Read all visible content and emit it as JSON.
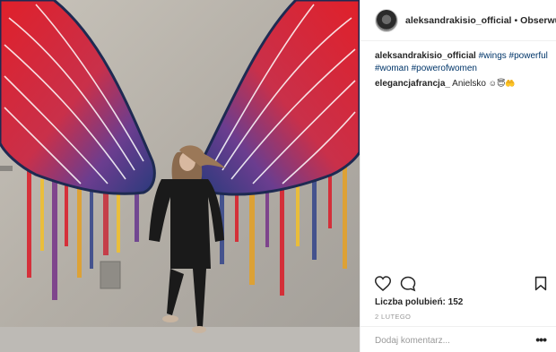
{
  "post": {
    "username": "aleksandrakisio_official",
    "follow_label": "Obserwuj",
    "separator": "•",
    "caption_user": "aleksandrakisio_official",
    "hashtags": [
      "#wings",
      "#powerful",
      "#woman",
      "#powerofwomen"
    ],
    "comment_user": "elegancjafrancja_",
    "comment_text": "Anielsko",
    "comment_emoji": "☺😇🤲",
    "likes_label": "Liczba polubień: 152",
    "date": "2 LUTEGO",
    "add_comment_placeholder": "Dodaj komentarz...",
    "more_label": "•••"
  },
  "icons": {
    "like": "heart-icon",
    "comment": "comment-icon",
    "save": "bookmark-icon",
    "more": "more-options-icon"
  },
  "colors": {
    "hashtag": "#003569",
    "text": "#262626",
    "muted": "#999999",
    "divider": "#efefef"
  }
}
